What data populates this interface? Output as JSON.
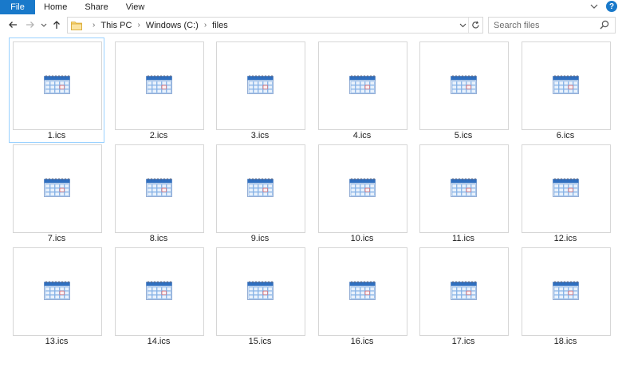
{
  "ribbon": {
    "file_label": "File",
    "tabs": [
      "Home",
      "Share",
      "View"
    ],
    "help_label": "?"
  },
  "nav": {
    "breadcrumb": [
      "This PC",
      "Windows (C:)",
      "files"
    ]
  },
  "search": {
    "placeholder": "Search files"
  },
  "files": [
    {
      "name": "1.ics",
      "selected": true
    },
    {
      "name": "2.ics"
    },
    {
      "name": "3.ics"
    },
    {
      "name": "4.ics"
    },
    {
      "name": "5.ics"
    },
    {
      "name": "6.ics"
    },
    {
      "name": "7.ics"
    },
    {
      "name": "8.ics"
    },
    {
      "name": "9.ics"
    },
    {
      "name": "10.ics"
    },
    {
      "name": "11.ics"
    },
    {
      "name": "12.ics"
    },
    {
      "name": "13.ics"
    },
    {
      "name": "14.ics"
    },
    {
      "name": "15.ics"
    },
    {
      "name": "16.ics"
    },
    {
      "name": "17.ics"
    },
    {
      "name": "18.ics"
    }
  ],
  "colors": {
    "accent": "#1979ca",
    "selection_border": "#99d1ff",
    "calendar_header": "#2f6fc0",
    "calendar_grid": "#6fa3e0",
    "calendar_highlight": "#e04040"
  },
  "icons": {
    "file_icon": "calendar-ics-icon",
    "folder": "folder-icon",
    "search": "search-icon",
    "back": "back-arrow-icon",
    "forward": "forward-arrow-icon",
    "recent": "recent-locations-icon",
    "up": "up-arrow-icon",
    "refresh": "refresh-icon"
  }
}
